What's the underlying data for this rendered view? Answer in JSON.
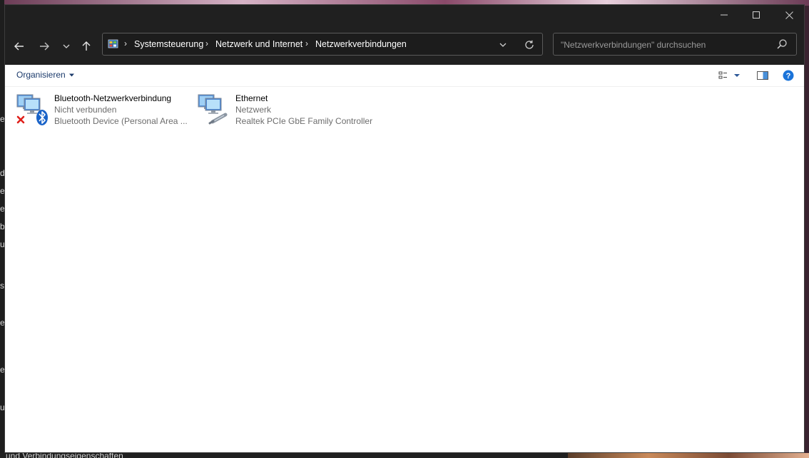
{
  "window": {
    "controls": {
      "minimize": "minimize-icon",
      "maximize": "maximize-icon",
      "close": "close-icon"
    }
  },
  "nav": {
    "back": "arrow-left-icon",
    "forward": "arrow-right-icon",
    "recent": "chevron-down-icon",
    "up": "arrow-up-icon"
  },
  "address": {
    "crumbs": [
      "Systemsteuerung",
      "Netzwerk und Internet",
      "Netzwerkverbindungen"
    ]
  },
  "search": {
    "placeholder": "\"Netzwerkverbindungen\" durchsuchen"
  },
  "toolbar": {
    "organize_label": "Organisieren"
  },
  "connections": [
    {
      "name": "Bluetooth-Netzwerkverbindung",
      "status": "Nicht verbunden",
      "device": "Bluetooth Device (Personal Area ...",
      "icon": "bluetooth-network-icon"
    },
    {
      "name": "Ethernet",
      "status": "Netzwerk",
      "device": "Realtek PCIe GbE Family Controller",
      "icon": "ethernet-network-icon"
    }
  ],
  "background": {
    "left_letters": [
      "e",
      "d",
      "e",
      "e",
      "b",
      "u",
      "s",
      "e",
      "e",
      "u"
    ],
    "bottom_text": "und Verbindungseigenschaften"
  },
  "colors": {
    "dark_chrome": "#202020",
    "accent": "#0078d4",
    "link_text": "#1b3a6b"
  }
}
